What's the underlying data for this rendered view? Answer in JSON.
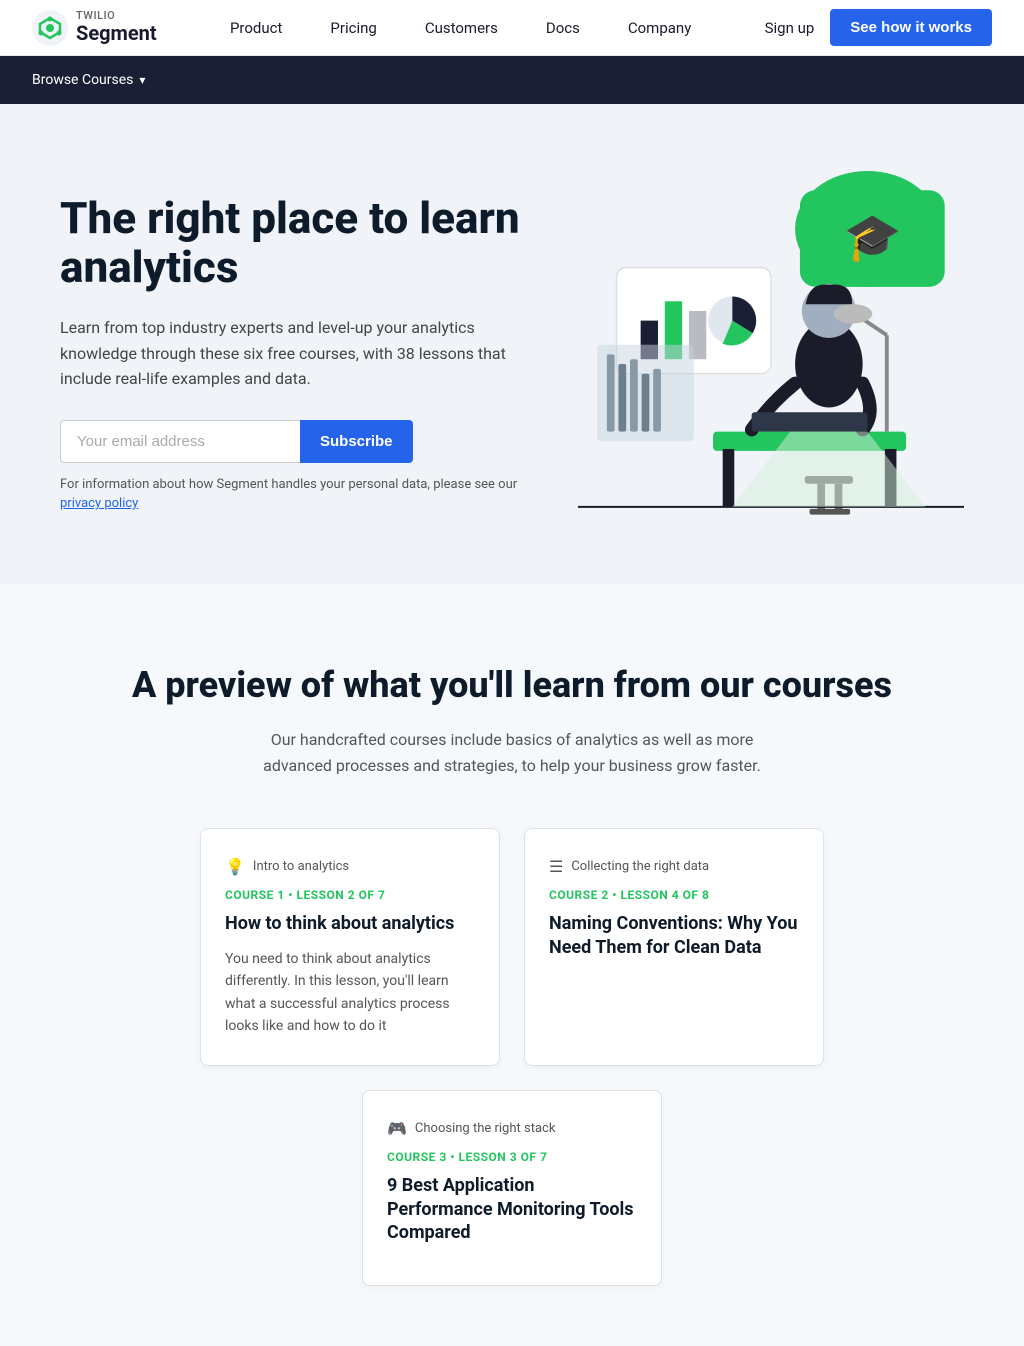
{
  "nav": {
    "logo_brand": "TWILIO",
    "logo_product": "Segment",
    "links": [
      {
        "label": "Product",
        "id": "product"
      },
      {
        "label": "Pricing",
        "id": "pricing"
      },
      {
        "label": "Customers",
        "id": "customers"
      },
      {
        "label": "Docs",
        "id": "docs"
      },
      {
        "label": "Company",
        "id": "company"
      }
    ],
    "signup_label": "Sign up",
    "cta_label": "See how it works"
  },
  "browse_bar": {
    "label": "Browse Courses"
  },
  "hero": {
    "title": "The right place to learn analytics",
    "description": "Learn from top industry experts and level-up your analytics knowledge through these six free courses, with 38 lessons that include real-life examples and data.",
    "input_placeholder": "Your email address",
    "subscribe_label": "Subscribe",
    "privacy_text": "For information about how Segment handles your personal data, please see our",
    "privacy_link": "privacy policy"
  },
  "preview": {
    "title": "A preview of what you'll learn from our courses",
    "description": "Our handcrafted courses include basics of analytics as well as more advanced processes and strategies, to help your business grow faster."
  },
  "courses": [
    {
      "category_icon": "💡",
      "category_label": "Intro to analytics",
      "course_line": "COURSE 1 • Lesson 2 of 7",
      "title": "How to think about analytics",
      "description": "You need to think about analytics differently. In this lesson, you'll learn what a successful analytics process looks like and how to do it"
    },
    {
      "category_icon": "☰",
      "category_label": "Collecting the right data",
      "course_line": "COURSE 2 • Lesson 4 of 8",
      "title": "Naming Conventions: Why You Need Them for Clean Data",
      "description": ""
    },
    {
      "category_icon": "🎮",
      "category_label": "Choosing the right stack",
      "course_line": "COURSE 3 • Lesson 3 of 7",
      "title": "9 Best Application Performance Monitoring Tools Compared",
      "description": ""
    }
  ]
}
